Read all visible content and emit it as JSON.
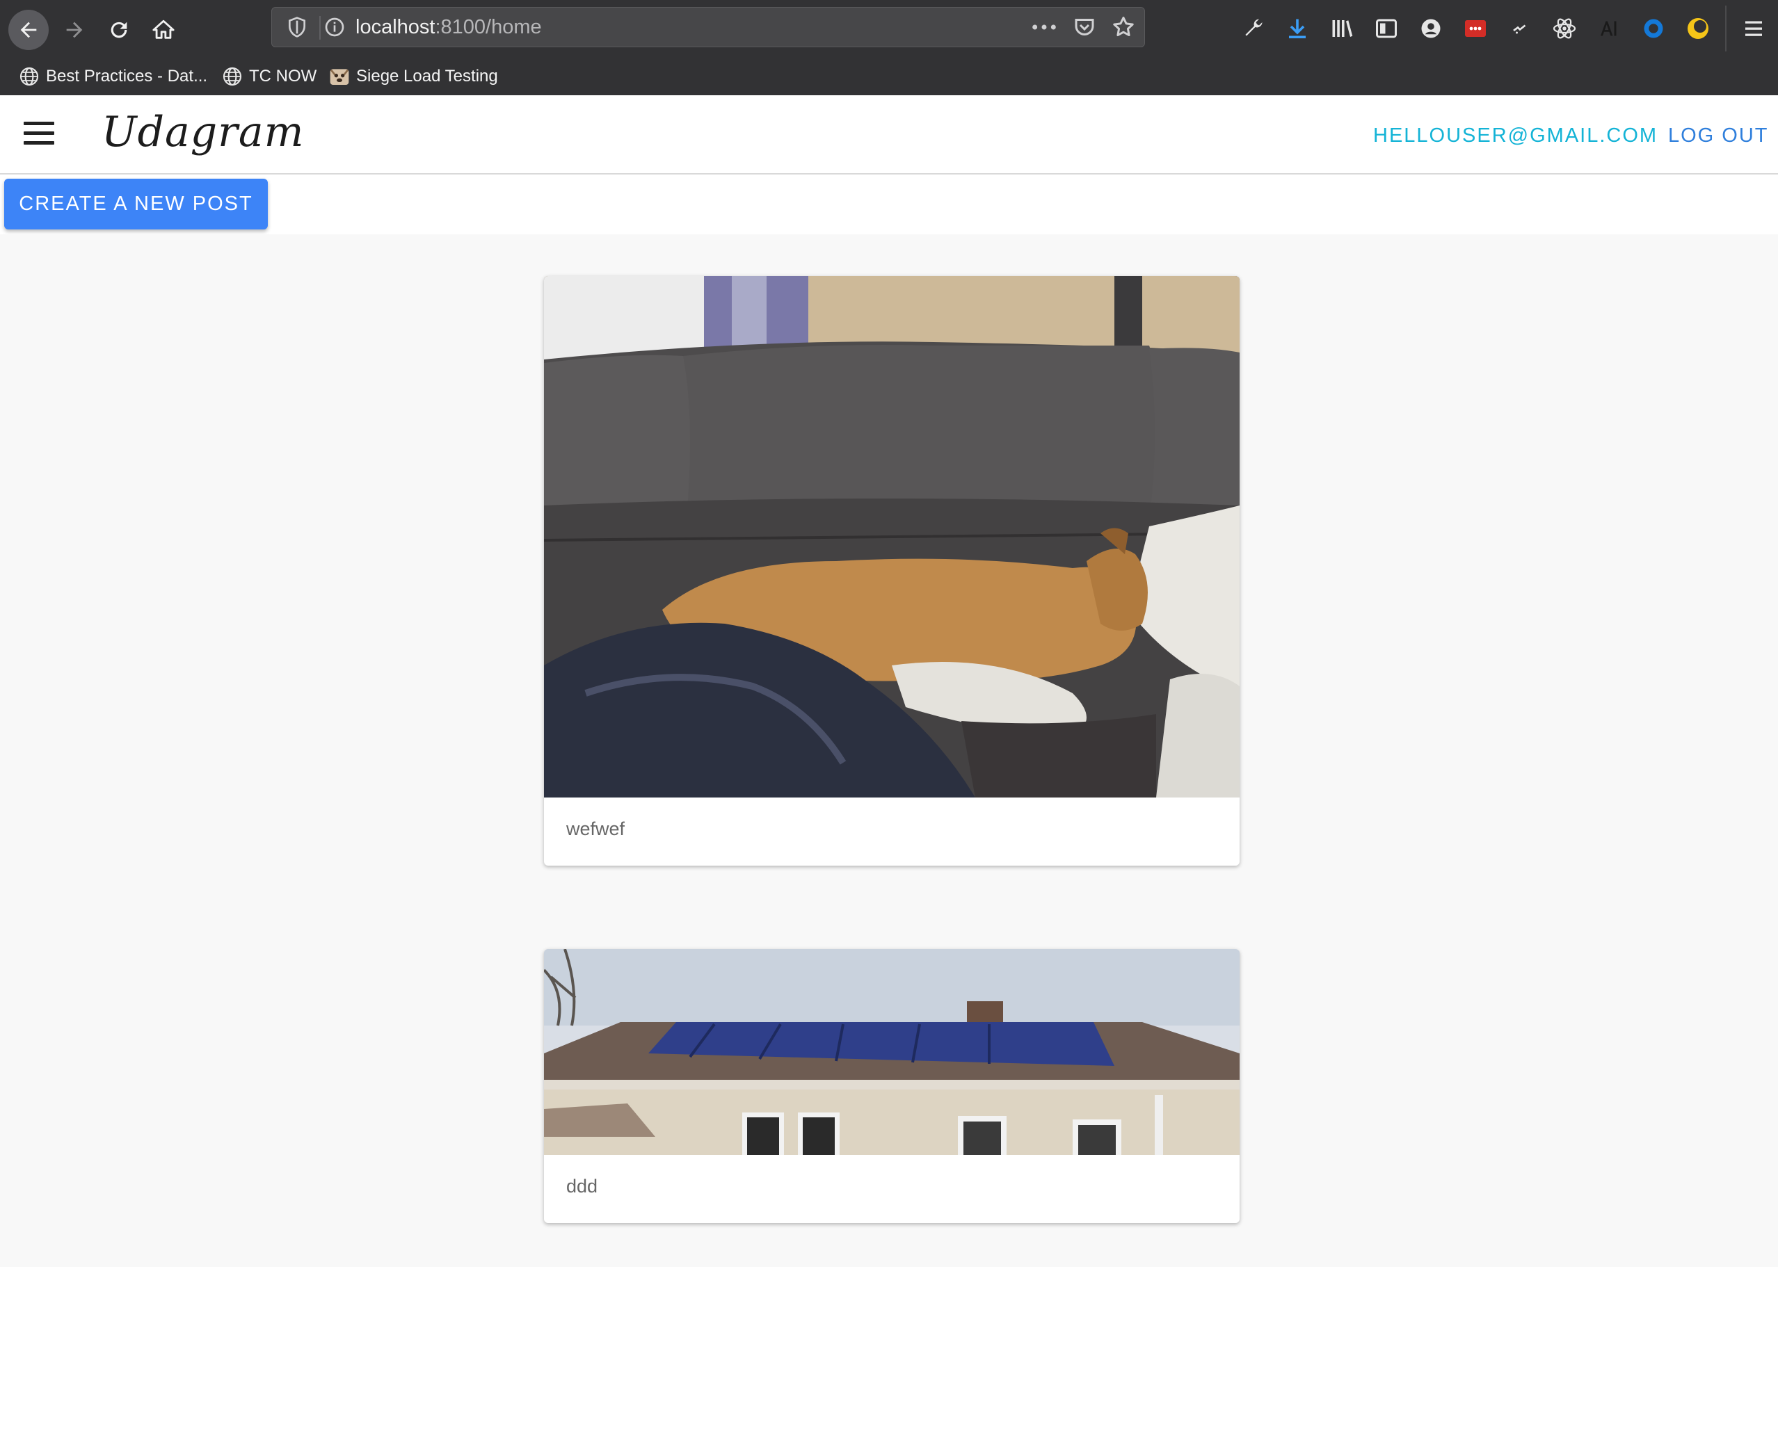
{
  "browser": {
    "url_host": "localhost",
    "url_rest": ":8100/home",
    "bookmarks": [
      {
        "label": "Best Practices - Dat...",
        "icon": "globe-icon"
      },
      {
        "label": "TC NOW",
        "icon": "globe-icon"
      },
      {
        "label": "Siege Load Testing",
        "icon": "dog-favicon-icon"
      }
    ],
    "toolbar_icons": [
      "wrench-icon",
      "download-icon",
      "library-icon",
      "sidebar-icon",
      "account-icon",
      "lastpass-icon",
      "extension-icon",
      "react-devtools-icon",
      "ai-icon",
      "circle-extension-icon",
      "moon-extension-icon",
      "hamburger-menu-icon"
    ]
  },
  "app": {
    "brand": "Udagram",
    "user_email": "HELLOUSER@GMAIL.COM",
    "logout_label": "LOG OUT",
    "create_post_label": "CREATE A NEW POST",
    "accent_color": "#3d84f7",
    "email_color": "#13b3d6"
  },
  "feed": {
    "posts": [
      {
        "caption": "wefwef",
        "image": "dog sleeping on leather couch"
      },
      {
        "caption": "ddd",
        "image": "house roof with solar panels"
      }
    ]
  }
}
